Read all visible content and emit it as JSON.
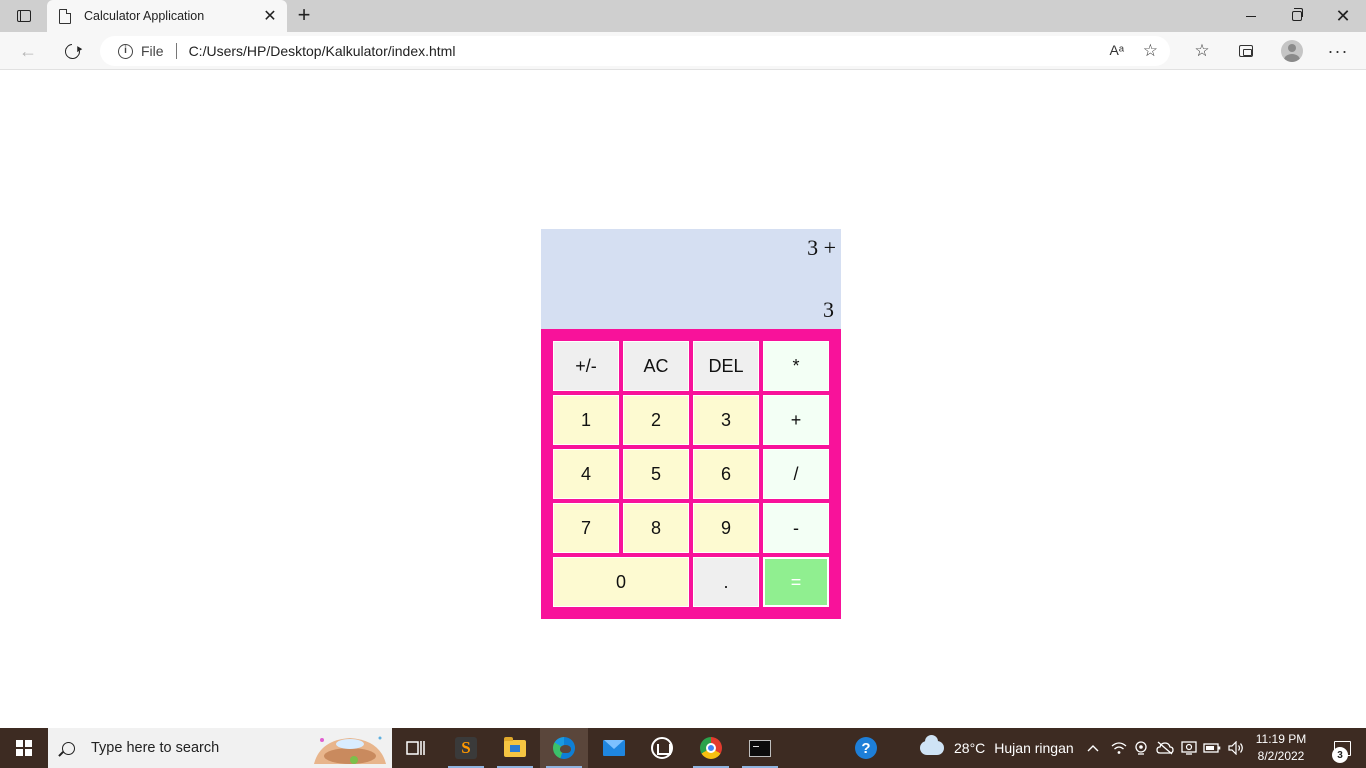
{
  "browser": {
    "tab": {
      "title": "Calculator Application",
      "close": "✕"
    },
    "new_tab": "+",
    "window": {
      "close": "✕"
    },
    "address": {
      "scheme_label": "File",
      "path": "C:/Users/HP/Desktop/Kalkulator/index.html"
    },
    "icons": {
      "back": "←",
      "read_aloud": "Aᵃ",
      "fav_add": "☆",
      "favorites": "☆",
      "more": "···"
    }
  },
  "calculator": {
    "previous_operand": "3 +",
    "current_operand": "3",
    "keys": [
      {
        "label": "+/-",
        "name": "key-plus-minus",
        "style": "gray"
      },
      {
        "label": "AC",
        "name": "key-all-clear",
        "style": "gray"
      },
      {
        "label": "DEL",
        "name": "key-delete",
        "style": "gray"
      },
      {
        "label": "*",
        "name": "key-multiply",
        "style": "mint"
      },
      {
        "label": "1",
        "name": "key-1",
        "style": "yellow"
      },
      {
        "label": "2",
        "name": "key-2",
        "style": "yellow"
      },
      {
        "label": "3",
        "name": "key-3",
        "style": "yellow"
      },
      {
        "label": "+",
        "name": "key-add",
        "style": "mint"
      },
      {
        "label": "4",
        "name": "key-4",
        "style": "yellow"
      },
      {
        "label": "5",
        "name": "key-5",
        "style": "yellow"
      },
      {
        "label": "6",
        "name": "key-6",
        "style": "yellow"
      },
      {
        "label": "/",
        "name": "key-divide",
        "style": "mint"
      },
      {
        "label": "7",
        "name": "key-7",
        "style": "yellow"
      },
      {
        "label": "8",
        "name": "key-8",
        "style": "yellow"
      },
      {
        "label": "9",
        "name": "key-9",
        "style": "yellow"
      },
      {
        "label": "-",
        "name": "key-subtract",
        "style": "mint"
      },
      {
        "label": "0",
        "name": "key-0",
        "style": "yellow"
      },
      {
        "label": ".",
        "name": "key-decimal",
        "style": "gray"
      },
      {
        "label": "=",
        "name": "key-equals",
        "style": "green"
      }
    ],
    "colors": {
      "display_bg": "#d5dff2",
      "keypad_bg": "#f8129a",
      "key_gray": "#efefef",
      "key_yellow": "#fdfad1",
      "key_mint": "#f3fff5",
      "key_equals": "#90ef90"
    }
  },
  "taskbar": {
    "search_placeholder": "Type here to search",
    "weather": {
      "temperature": "28°C",
      "condition": "Hujan ringan"
    },
    "clock": {
      "time": "11:19 PM",
      "date": "8/2/2022"
    },
    "notifications_count": "3",
    "apps": [
      "task-view",
      "sublime-text",
      "file-explorer",
      "microsoft-edge",
      "mail",
      "microsoft-store",
      "google-chrome",
      "command-prompt",
      "get-help"
    ]
  }
}
